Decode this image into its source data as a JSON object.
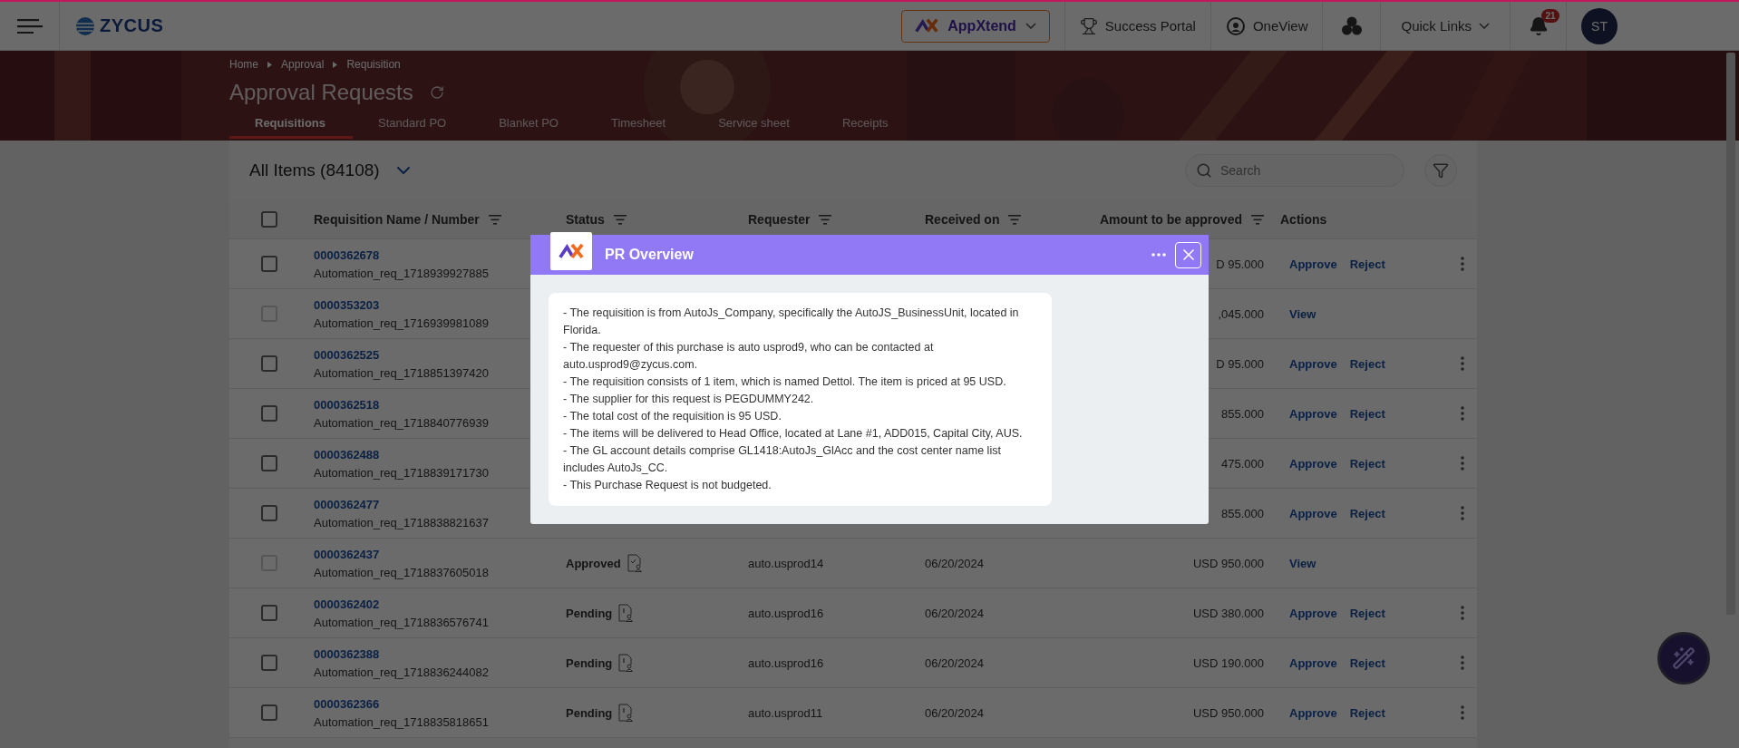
{
  "top_bar": {
    "logo": "ZYCUS",
    "appxtend": "AppXtend",
    "links": [
      {
        "label": "Success Portal",
        "kind": "trophy"
      },
      {
        "label": "OneView",
        "kind": "oneview"
      }
    ],
    "quick_links": "Quick Links",
    "notification_count": "21",
    "avatar": "ST"
  },
  "header": {
    "breadcrumb": [
      "Home",
      "Approval",
      "Requisition"
    ],
    "title": "Approval Requests",
    "tabs": [
      {
        "label": "Requisitions",
        "selected": true
      },
      {
        "label": "Standard PO",
        "selected": false
      },
      {
        "label": "Blanket PO",
        "selected": false
      },
      {
        "label": "Timesheet",
        "selected": false
      },
      {
        "label": "Service sheet",
        "selected": false
      },
      {
        "label": "Receipts",
        "selected": false
      }
    ]
  },
  "list": {
    "title": "All Items (84108)",
    "search": {
      "placeholder": "Search"
    }
  },
  "table": {
    "select_all": {
      "checked": false
    },
    "columns": [
      {
        "label": "Requisition Name / Number",
        "sortable": true
      },
      {
        "label": "Status",
        "sortable": true
      },
      {
        "label": "Requester",
        "sortable": true
      },
      {
        "label": "Received on",
        "sortable": true
      },
      {
        "label": "Amount to be approved",
        "sortable": true
      },
      {
        "label": "Actions",
        "sortable": false
      }
    ],
    "rows": [
      {
        "number": "0000362678",
        "name": "Automation_req_1718939927885",
        "disabled": false,
        "amount": "D 95.000",
        "actions": [
          "Approve",
          "Reject"
        ],
        "menu": true
      },
      {
        "number": "0000353203",
        "name": "Automation_req_1716939981089",
        "disabled": true,
        "amount": ",045.000",
        "actions": [
          "View"
        ],
        "menu": false
      },
      {
        "number": "0000362525",
        "name": "Automation_req_1718851397420",
        "disabled": false,
        "amount": "D 95.000",
        "actions": [
          "Approve",
          "Reject"
        ],
        "menu": true
      },
      {
        "number": "0000362518",
        "name": "Automation_req_1718840776939",
        "disabled": false,
        "amount": "855.000",
        "actions": [
          "Approve",
          "Reject"
        ],
        "menu": true
      },
      {
        "number": "0000362488",
        "name": "Automation_req_1718839171730",
        "disabled": false,
        "amount": "475.000",
        "actions": [
          "Approve",
          "Reject"
        ],
        "menu": true
      },
      {
        "number": "0000362477",
        "name": "Automation_req_1718838821637",
        "disabled": false,
        "amount": "855.000",
        "actions": [
          "Approve",
          "Reject"
        ],
        "menu": true
      },
      {
        "number": "0000362437",
        "name": "Automation_req_1718837605018",
        "disabled": true,
        "status": {
          "label": "Approved",
          "kind": "approved"
        },
        "requester": "auto.usprod14",
        "received": "06/20/2024",
        "amount": "USD 950.000",
        "actions": [
          "View"
        ],
        "menu": false
      },
      {
        "number": "0000362402",
        "name": "Automation_req_1718836576741",
        "disabled": false,
        "status": {
          "label": "Pending",
          "kind": "pending"
        },
        "requester": "auto.usprod16",
        "received": "06/20/2024",
        "amount": "USD 380.000",
        "actions": [
          "Approve",
          "Reject"
        ],
        "menu": true
      },
      {
        "number": "0000362388",
        "name": "Automation_req_1718836244082",
        "disabled": false,
        "status": {
          "label": "Pending",
          "kind": "pending"
        },
        "requester": "auto.usprod16",
        "received": "06/20/2024",
        "amount": "USD 190.000",
        "actions": [
          "Approve",
          "Reject"
        ],
        "menu": true
      },
      {
        "number": "0000362366",
        "name": "Automation_req_1718835818651",
        "disabled": false,
        "status": {
          "label": "Pending",
          "kind": "pending"
        },
        "requester": "auto.usprod11",
        "received": "06/20/2024",
        "amount": "USD 950.000",
        "actions": [
          "Approve",
          "Reject"
        ],
        "menu": true
      }
    ]
  },
  "modal": {
    "title": "PR Overview",
    "lines": [
      "- The requisition is from AutoJs_Company, specifically the AutoJS_BusinessUnit, located in Florida.",
      "- The requester of this purchase is auto usprod9, who can be contacted at auto.usprod9@zycus.com.",
      "- The requisition consists of 1 item, which is named Dettol. The item is priced at 95 USD.",
      "- The supplier for this request is PEGDUMMY242.",
      "- The total cost of the requisition is 95 USD.",
      "- The items will be delivered to Head Office, located at Lane #1, ADD015, Capital City, AUS.",
      "- The GL account details comprise GL1418:AutoJs_GlAcc and the cost center name list includes AutoJs_CC.",
      "- This Purchase Request is not budgeted."
    ]
  }
}
